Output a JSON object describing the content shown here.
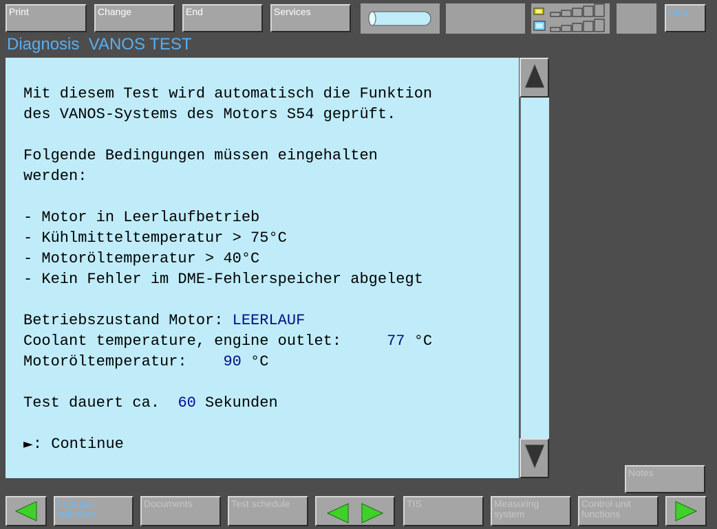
{
  "toolbar": {
    "print": "Print",
    "change": "Change",
    "end": "End",
    "services": "Services",
    "help": "Help"
  },
  "header": {
    "section": "Diagnosis",
    "test_name": "VANOS TEST"
  },
  "content": {
    "intro_line1": "Mit diesem Test wird automatisch die Funktion",
    "intro_line2": "des VANOS-Systems des Motors S54 geprüft.",
    "cond_line1": "Folgende Bedingungen müssen eingehalten",
    "cond_line2": "werden:",
    "conditions": [
      "- Motor in Leerlaufbetrieb",
      "- Kühlmitteltemperatur > 75°C",
      "- Motoröltemperatur > 40°C",
      "- Kein Fehler im DME-Fehlerspeicher abgelegt"
    ],
    "state_label": "Betriebszustand Motor: ",
    "state_value": "LEERLAUF",
    "coolant_label": "Coolant temperature, engine outlet:     ",
    "coolant_value": "77",
    "coolant_unit": " °C",
    "oil_label": "Motoröltemperatur:    ",
    "oil_value": "90",
    "oil_unit": " °C",
    "duration_label": "Test dauert ca.  ",
    "duration_value": "60",
    "duration_unit": " Sekunden",
    "continue_symbol": "►",
    "continue_label": ": Continue"
  },
  "side": {
    "notes": "Notes"
  },
  "bottom": {
    "function_selection": "Function selection",
    "documents": "Documents",
    "test_schedule": "Test schedule",
    "tis": "TIS",
    "measuring_system": "Measuring system",
    "control_unit_functions": "Control unit functions"
  },
  "colors": {
    "background": "#4d4d4d",
    "content": "#c0ecfa",
    "value_text": "#000e8a",
    "title_text": "#5aaef0",
    "arrow_green": "#3fd12a"
  }
}
